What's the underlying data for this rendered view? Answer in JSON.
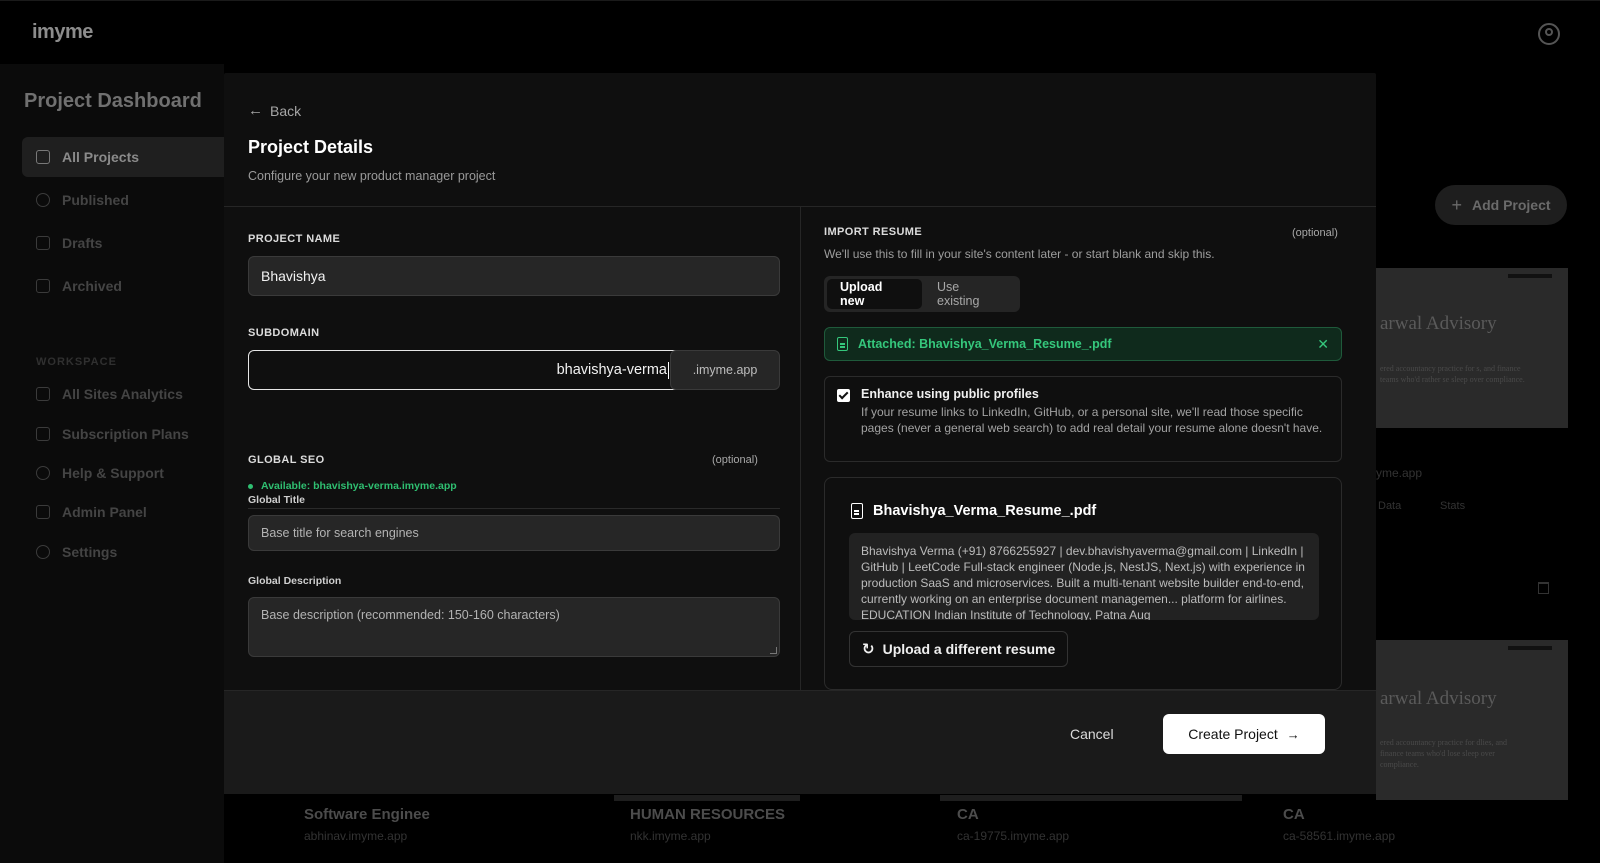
{
  "app": {
    "logo": "imyme"
  },
  "sidebar": {
    "title": "Project Dashboard",
    "items": [
      {
        "label": "All Projects",
        "icon": "grid-icon"
      },
      {
        "label": "Published",
        "icon": "globe-icon"
      },
      {
        "label": "Drafts",
        "icon": "file-icon"
      },
      {
        "label": "Archived",
        "icon": "archive-icon"
      }
    ],
    "workspace_label": "WORKSPACE",
    "workspace_items": [
      {
        "label": "All Sites Analytics",
        "icon": "bar-chart-icon"
      },
      {
        "label": "Subscription Plans",
        "icon": "credit-card-icon"
      },
      {
        "label": "Help & Support",
        "icon": "help-icon"
      },
      {
        "label": "Admin Panel",
        "icon": "grid-icon"
      },
      {
        "label": "Settings",
        "icon": "gear-icon"
      }
    ]
  },
  "background": {
    "add_project": "Add Project",
    "card_preview_title": "arwal Advisory",
    "card_preview_text_1": "ered accountancy practice for s, and finance teams who'd rather se sleep over compliance.",
    "card_preview_text_2": "ered accountancy practice for dlies, and finance teams who'd lose sleep over compliance.",
    "card_url_fragment": "yme.app",
    "card_data": "Data",
    "card_stats": "Stats",
    "bottom_cards": [
      {
        "title": "Software Enginee",
        "url": "abhinav.imyme.app"
      },
      {
        "title": "HUMAN RESOURCES",
        "url": "nkk.imyme.app"
      },
      {
        "title": "CA",
        "url": "ca-19775.imyme.app"
      },
      {
        "title": "CA",
        "url": "ca-58561.imyme.app"
      }
    ]
  },
  "modal": {
    "back": "Back",
    "title": "Project Details",
    "subtitle": "Configure your new product manager project",
    "project_name_label": "PROJECT NAME",
    "project_name_value": "Bhavishya",
    "subdomain_label": "SUBDOMAIN",
    "subdomain_value": "bhavishya-verma",
    "subdomain_suffix": ".imyme.app",
    "availability": "Available: bhavishya-verma.imyme.app",
    "seo_label": "GLOBAL SEO",
    "seo_optional": "(optional)",
    "global_title_label": "Global Title",
    "global_title_placeholder": "Base title for search engines",
    "global_desc_label": "Global Description",
    "global_desc_placeholder": "Base description (recommended: 150-160 characters)",
    "import_label": "IMPORT RESUME",
    "import_optional": "(optional)",
    "import_desc": "We'll use this to fill in your site's content later - or start blank and skip this.",
    "tabs": [
      "Upload new",
      "Use existing"
    ],
    "attached": "Attached: Bhavishya_Verma_Resume_.pdf",
    "enhance_title": "Enhance using public profiles",
    "enhance_body": "If your resume links to LinkedIn, GitHub, or a personal site, we'll read those specific pages (never a general web search) to add real detail your resume alone doesn't have.",
    "enhance_checked": true,
    "resume_filename": "Bhavishya_Verma_Resume_.pdf",
    "resume_preview": "Bhavishya Verma (+91) 8766255927 | dev.bhavishyaverma@gmail.com | LinkedIn | GitHub | LeetCode Full-stack engineer (Node.js, NestJS, Next.js) with experience in production SaaS and microservices. Built a multi-tenant website builder end-to-end, currently working on an enterprise document managemen... platform for airlines. EDUCATION Indian Institute of Technology, Patna Aug",
    "upload_different": "Upload a different resume",
    "cancel": "Cancel",
    "create": "Create Project"
  },
  "colors": {
    "accent_green": "#35c77c",
    "modal_bg": "#0f0f0f",
    "primary_button": "#ffffff"
  }
}
